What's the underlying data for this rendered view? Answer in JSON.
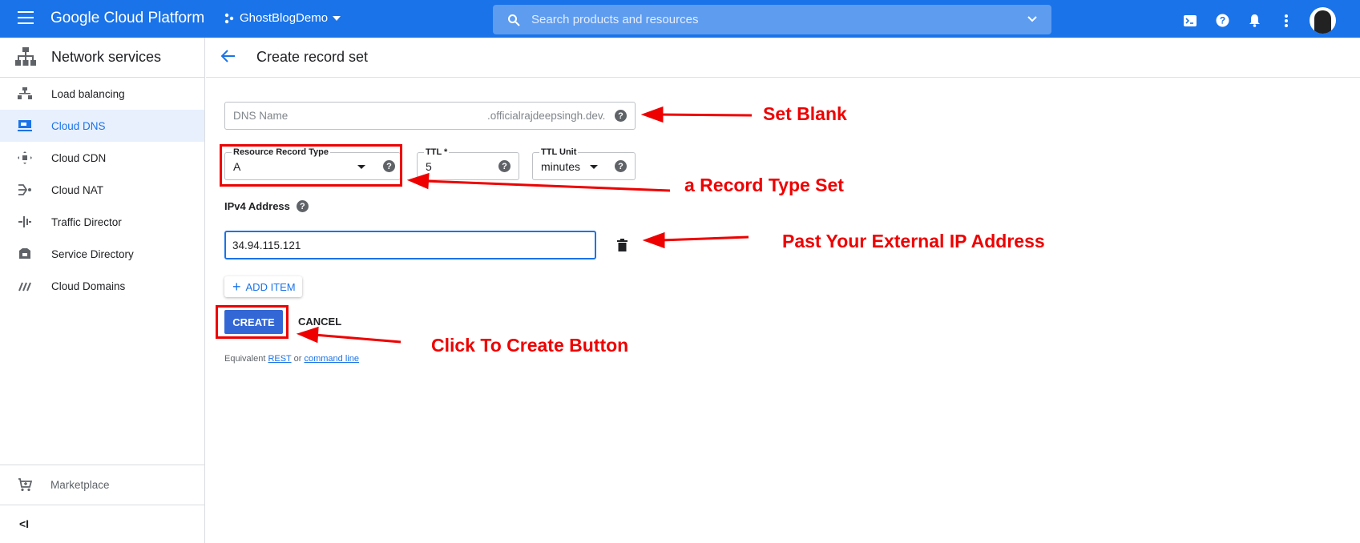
{
  "header": {
    "brand": "Google Cloud Platform",
    "project": "GhostBlogDemo",
    "search_placeholder": "Search products and resources"
  },
  "sidebar": {
    "title": "Network services",
    "items": [
      {
        "label": "Load balancing",
        "icon": "load-balancing-icon"
      },
      {
        "label": "Cloud DNS",
        "icon": "cloud-dns-icon",
        "active": true
      },
      {
        "label": "Cloud CDN",
        "icon": "cloud-cdn-icon"
      },
      {
        "label": "Cloud NAT",
        "icon": "cloud-nat-icon"
      },
      {
        "label": "Traffic Director",
        "icon": "traffic-director-icon"
      },
      {
        "label": "Service Directory",
        "icon": "service-directory-icon"
      },
      {
        "label": "Cloud Domains",
        "icon": "cloud-domains-icon"
      }
    ],
    "marketplace": "Marketplace",
    "collapse": "<I"
  },
  "page": {
    "title": "Create record set"
  },
  "form": {
    "dns_name_placeholder": "DNS Name",
    "dns_suffix": ".officialrajdeepsingh.dev.",
    "record_type_label": "Resource Record Type",
    "record_type_value": "A",
    "ttl_label": "TTL *",
    "ttl_value": "5",
    "ttl_unit_label": "TTL Unit",
    "ttl_unit_value": "minutes",
    "ipv4_label": "IPv4 Address",
    "ipv4_value": "34.94.115.121",
    "add_item": "ADD ITEM",
    "create": "CREATE",
    "cancel": "CANCEL",
    "footer_prefix": "Equivalent",
    "footer_rest": "REST",
    "footer_or": "or",
    "footer_cli": "command line"
  },
  "annotations": {
    "set_blank": "Set Blank",
    "record_type": "a Record Type Set",
    "ip_address": "Past Your External IP Address",
    "create_button": "Click To Create Button"
  },
  "colors": {
    "accent": "#1a73e8",
    "annotation": "#ee0000",
    "create_button": "#3367d6"
  }
}
